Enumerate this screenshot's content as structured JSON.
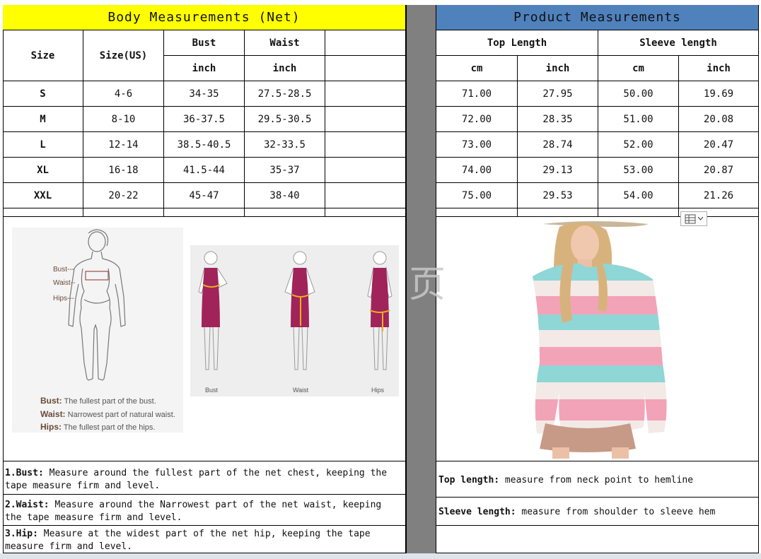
{
  "left_header": {
    "title": "Body Measurements (Net)",
    "bg": "#ffff00"
  },
  "right_header": {
    "title": "Product Measurements",
    "bg": "#4f81bd"
  },
  "body_columns": {
    "size": "Size",
    "size_us": "Size(US)",
    "bust": "Bust",
    "waist": "Waist",
    "bust_unit": "inch",
    "waist_unit": "inch"
  },
  "product_columns": {
    "top_length": "Top Length",
    "sleeve_length": "Sleeve length",
    "units": [
      "cm",
      "inch",
      "cm",
      "inch"
    ]
  },
  "rows": [
    {
      "size": "S",
      "us": "4-6",
      "bust": "34-35",
      "waist": "27.5-28.5",
      "tl_cm": "71.00",
      "tl_in": "27.95",
      "sl_cm": "50.00",
      "sl_in": "19.69"
    },
    {
      "size": "M",
      "us": "8-10",
      "bust": "36-37.5",
      "waist": "29.5-30.5",
      "tl_cm": "72.00",
      "tl_in": "28.35",
      "sl_cm": "51.00",
      "sl_in": "20.08"
    },
    {
      "size": "L",
      "us": "12-14",
      "bust": "38.5-40.5",
      "waist": "32-33.5",
      "tl_cm": "73.00",
      "tl_in": "28.74",
      "sl_cm": "52.00",
      "sl_in": "20.47"
    },
    {
      "size": "XL",
      "us": "16-18",
      "bust": "41.5-44",
      "waist": "35-37",
      "tl_cm": "74.00",
      "tl_in": "29.13",
      "sl_cm": "53.00",
      "sl_in": "20.87"
    },
    {
      "size": "XXL",
      "us": "20-22",
      "bust": "45-47",
      "waist": "38-40",
      "tl_cm": "75.00",
      "tl_in": "29.53",
      "sl_cm": "54.00",
      "sl_in": "21.26"
    }
  ],
  "figure1": {
    "labels": [
      "Bust---",
      "Waist--",
      "Hips---"
    ],
    "definitions": [
      {
        "term": "Bust:",
        "text": "The fullest part of the bust."
      },
      {
        "term": "Waist:",
        "text": "Narrowest part of natural waist."
      },
      {
        "term": "Hips:",
        "text": "The fullest part of the hips."
      }
    ]
  },
  "figure2": {
    "captions": [
      "Bust",
      "Waist",
      "Hips"
    ]
  },
  "watermark": "页",
  "notes_left": [
    {
      "term": "1.Bust:",
      "text": " Measure around the fullest part of the net chest, keeping the tape  measure firm and level."
    },
    {
      "term": "2.Waist:",
      "text": " Measure around the Narrowest part of the net waist, keeping the tape  measure firm and level."
    },
    {
      "term": "3.Hip:",
      "text": " Measure at the widest part of the net hip, keeping the tape measure firm and level."
    }
  ],
  "notes_right": [
    {
      "term": "Top length:",
      "text": " measure from neck point to hemline"
    },
    {
      "term": "Sleeve length:",
      "text": " measure from shoulder to sleeve hem"
    }
  ],
  "colors": {
    "divider": "#808080",
    "garment_fill": "#a0245a",
    "sweater_pink": "#f2a3b8",
    "sweater_teal": "#8fd6d6",
    "sweater_cream": "#f3e9e6"
  },
  "icons": {
    "paste_options": "clipboard-icon"
  }
}
